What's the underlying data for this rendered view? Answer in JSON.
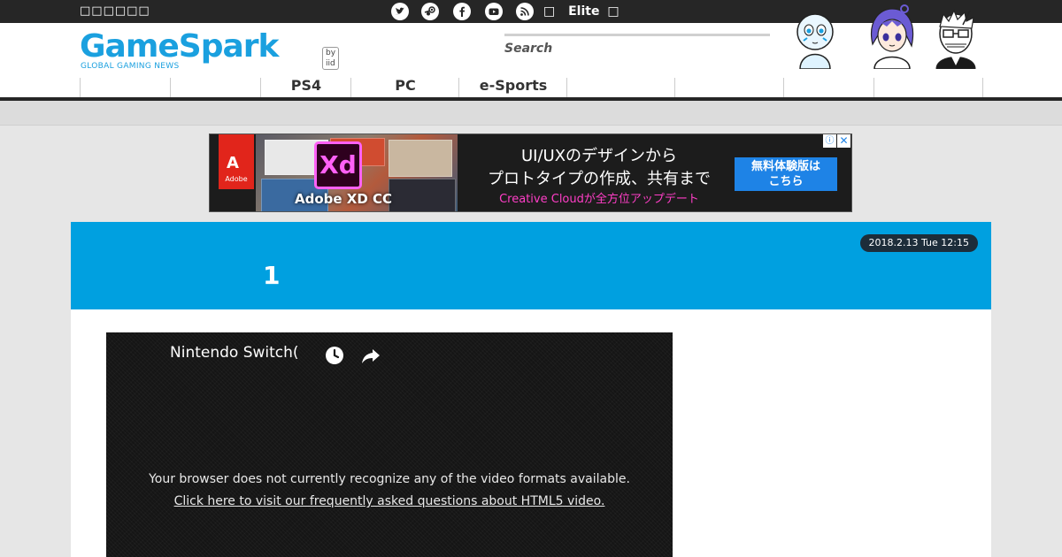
{
  "topbar": {
    "tagline": "□□□□□□",
    "social_icons": [
      "twitter-icon",
      "steam-icon",
      "facebook-icon",
      "youtube-icon",
      "rss-icon"
    ],
    "elite_prefix": "□",
    "elite_label": "Elite",
    "elite_suffix": "□"
  },
  "header": {
    "logo_text": "GameSpark",
    "logo_sub": "GLOBAL GAMING NEWS",
    "logo_by": "by iid",
    "search_placeholder": "Search"
  },
  "nav": {
    "items": [
      "",
      "",
      "PS4",
      "PC",
      "e-Sports",
      "",
      "",
      "",
      ""
    ]
  },
  "ad": {
    "adobe_mark": "A",
    "adobe_text": "Adobe",
    "xd_badge": "Xd",
    "product": "Adobe XD CC",
    "headline1": "UI/UXのデザインから",
    "headline2": "プロトタイプの作成、共有まで",
    "tagline": "Creative Cloudが全方位アップデート",
    "cta_line1": "無料体験版は",
    "cta_line2": "こちら",
    "info": "ⓘ",
    "close": "✕"
  },
  "article": {
    "date": "2018.2.13 Tue 12:15",
    "title": "1"
  },
  "video": {
    "title": "Nintendo Switch(",
    "message": "Your browser does not currently recognize any of the video formats available.",
    "link": "Click here to visit our frequently asked questions about HTML5 video."
  },
  "colors": {
    "brand_blue": "#00a0e0",
    "topbar": "#262626"
  }
}
